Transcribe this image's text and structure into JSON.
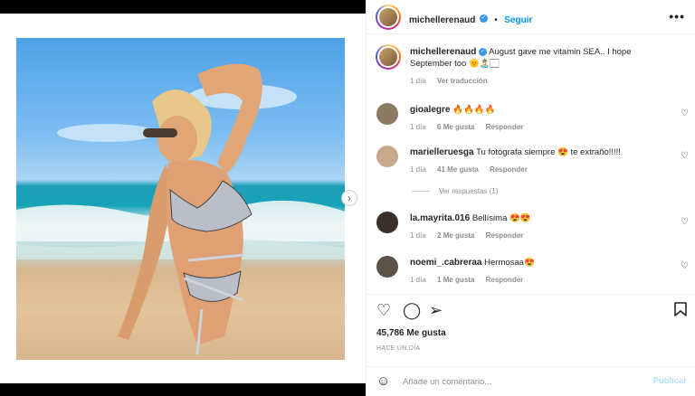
{
  "post": {
    "username": "michellerenaud",
    "follow_label": "Seguir",
    "more_label": "•••",
    "caption": "August gave me vitamin SEA.. I hope September too 🌞🏝️🏻",
    "caption_age": "1 día",
    "see_translation": "Ver traducción"
  },
  "comments": [
    {
      "username": "gioalegre",
      "text": "🔥🔥🔥🔥",
      "age": "1 día",
      "likes": "6 Me gusta",
      "reply": "Responder"
    },
    {
      "username": "marielleruesga",
      "text": "Tu fotógrafa siempre 😍 te extraño!!!!!",
      "age": "1 día",
      "likes": "41 Me gusta",
      "reply": "Responder"
    },
    {
      "username": "la.mayrita.016",
      "text": "Bellísima 😍😍",
      "age": "1 día",
      "likes": "2 Me gusta",
      "reply": "Responder"
    },
    {
      "username": "noemi_.cabreraa",
      "text": "Hermosaa😍",
      "age": "1 día",
      "likes": "1 Me gusta",
      "reply": "Responder"
    }
  ],
  "view_replies": "Ver respuestas (1)",
  "actions": {
    "like_icon": "heart-icon",
    "comment_icon": "comment-icon",
    "share_icon": "share-icon",
    "save_icon": "bookmark-icon"
  },
  "likes_count": "45,786 Me gusta",
  "posted_time": "HACE UN DÍA",
  "comment_box": {
    "placeholder": "Añade un comentario...",
    "publish_label": "Publicar"
  },
  "colors": {
    "accent": "#0095f6",
    "verified": "#3897f0",
    "muted": "#8e8e8e",
    "publish_disabled": "#b2dffc"
  }
}
